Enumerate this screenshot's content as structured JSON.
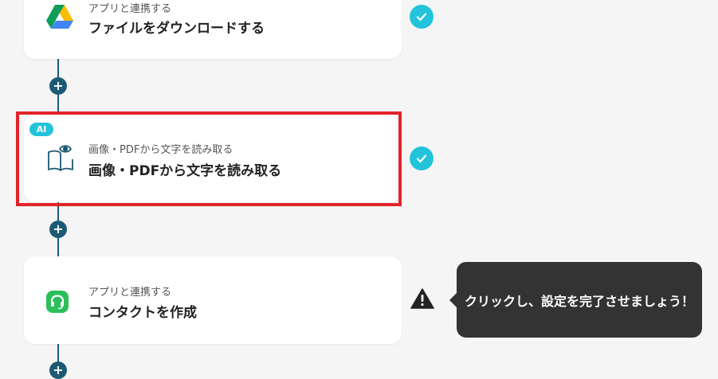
{
  "steps": [
    {
      "subtitle": "アプリと連携する",
      "title": "ファイルをダウンロードする",
      "icon": "google-drive-icon",
      "status": "completed"
    },
    {
      "badge": "AI",
      "subtitle": "画像・PDFから文字を読み取る",
      "title": "画像・PDFから文字を読み取る",
      "icon": "book-eye-icon",
      "status": "completed",
      "highlighted": true
    },
    {
      "subtitle": "アプリと連携する",
      "title": "コンタクトを作成",
      "icon": "headset-icon",
      "status": "warning"
    }
  ],
  "add_button_label": "+",
  "tooltip": {
    "text": "クリックし、設定を完了させましょう！"
  },
  "colors": {
    "connector": "#1d5a73",
    "check": "#22c3db",
    "highlight": "#e1232a",
    "tooltip_bg": "#333333",
    "app_green": "#2bbf5a"
  }
}
